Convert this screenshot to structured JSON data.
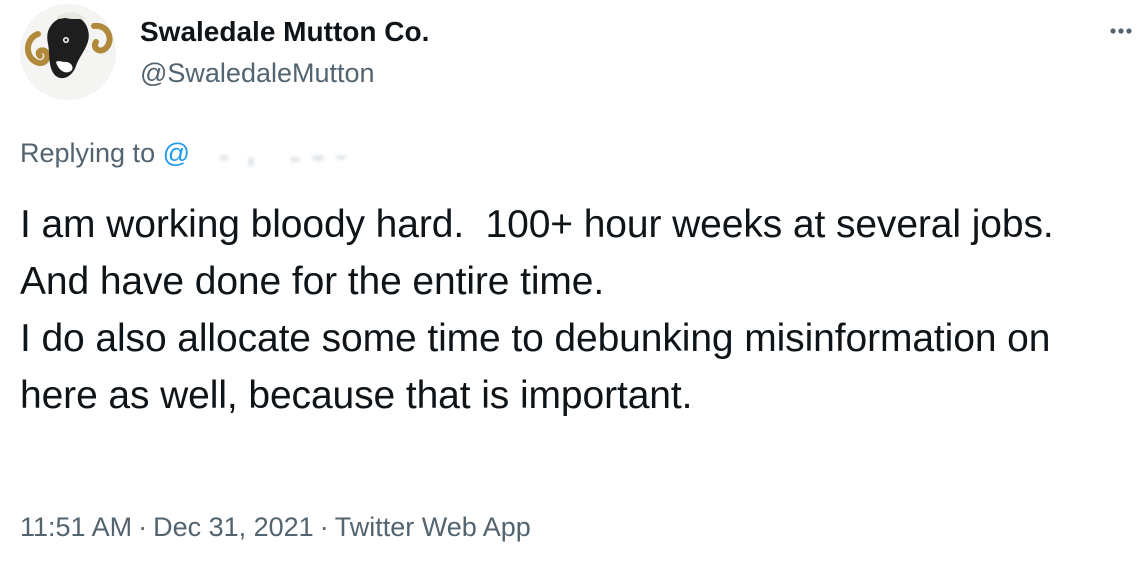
{
  "author": {
    "display_name": "Swaledale Mutton Co.",
    "handle": "@SwaledaleMutton",
    "avatar_icon": "ram-head-avatar"
  },
  "reply": {
    "prefix": "Replying to ",
    "mention": "@"
  },
  "tweet": {
    "text": "I am working bloody hard.  100+ hour weeks at several jobs.  And have done for the entire time.\nI do also allocate some time to debunking misinformation on here as well, because that is important."
  },
  "meta": {
    "time": "11:51 AM",
    "separator": "·",
    "date": "Dec 31, 2021",
    "source": "Twitter Web App"
  },
  "colors": {
    "text_primary": "#0f1419",
    "text_secondary": "#536471",
    "link": "#1d9bf0"
  },
  "icons": {
    "more": "more-options-icon"
  }
}
